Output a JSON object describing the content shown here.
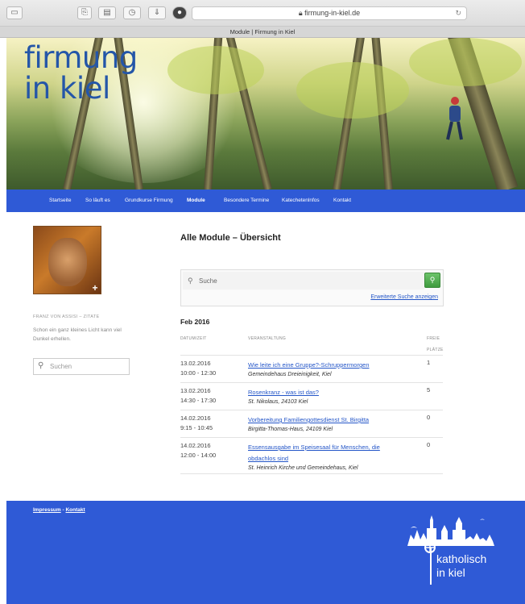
{
  "browser": {
    "url": "firmung-in-kiel.de",
    "tab_title": "Module | Firmung in Kiel"
  },
  "site": {
    "title_line1": "firmung",
    "title_line2": "in kiel"
  },
  "nav": {
    "items": [
      "Startseite",
      "So läuft es",
      "Grundkurse Firmung",
      "Module",
      "Besondere Termine",
      "Katechetenlnfos",
      "Kontakt"
    ],
    "active": "Module"
  },
  "sidebar": {
    "quote_source": "FRANZ VON ASSISI – ZITATE",
    "quote_text": "Schon ein ganz kleines Licht kann viel Dunkel erhellen.",
    "search_placeholder": "Suchen"
  },
  "main": {
    "title": "Alle Module – Übersicht",
    "search_placeholder": "Suche",
    "advanced_search": "Erweiterte Suche anzeigen",
    "month": "Feb 2016",
    "columns": {
      "date": "DATUM/ZEIT",
      "event": "VERANSTALTUNG",
      "free_line1": "FREIE",
      "free_line2": "PLÄTZE"
    },
    "events": [
      {
        "date": "13.02.2016",
        "time": "10:00 - 12:30",
        "title": "Wie leite ich eine Gruppe?-Schruppermorgen",
        "location": "Gemeindehaus Dreieinigkeit, Kiel",
        "free": "1"
      },
      {
        "date": "13.02.2016",
        "time": "14:30 - 17:30",
        "title": "Rosenkranz - was ist das?",
        "location": "St. Nikolaus, 24103 Kiel",
        "free": "5"
      },
      {
        "date": "14.02.2016",
        "time": "9:15 - 10:45",
        "title": "Vorbereitung Familiengottesdienst St. Birgitta",
        "location": "Birgitta-Thomas-Haus, 24109 Kiel",
        "free": "0"
      },
      {
        "date": "14.02.2016",
        "time": "12:00 - 14:00",
        "title_line1": "Essensausgabe im Speisesaal für Menschen, die",
        "title_line2": "obdachlos sind",
        "location": "St. Heinrich Kirche und Gemeindehaus, Kiel",
        "free": "0"
      }
    ]
  },
  "footer": {
    "impressum": "Impressum",
    "separator": " - ",
    "kontakt": "Kontakt",
    "logo_line1": "katholisch",
    "logo_line2": "in kiel"
  },
  "colors": {
    "brand_blue": "#2f5ad6",
    "link_blue": "#2456c8",
    "title_blue": "#2456a8",
    "search_green": "#4caf4b"
  }
}
